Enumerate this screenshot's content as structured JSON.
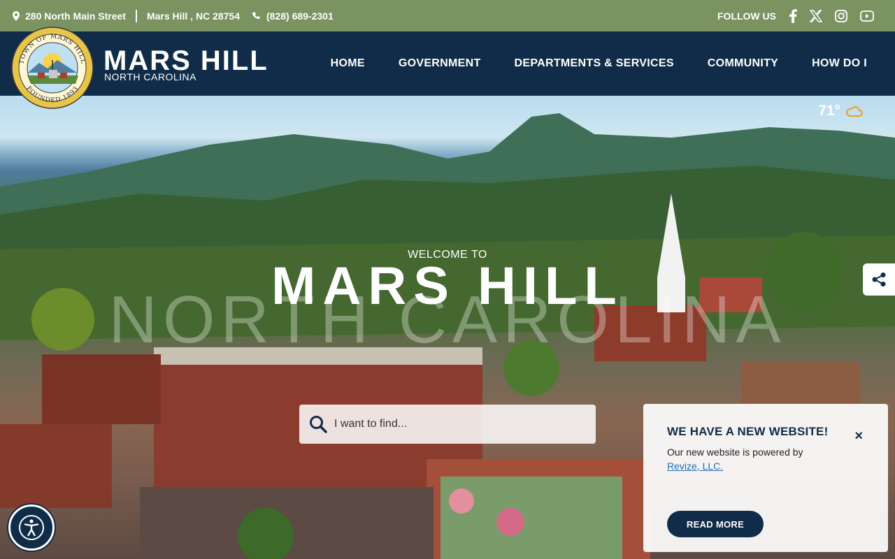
{
  "topbar": {
    "address": "280 North Main Street",
    "city": "Mars Hill , NC 28754",
    "phone": "(828) 689-2301",
    "follow_label": "FOLLOW US",
    "social_icons": [
      "facebook-icon",
      "x-icon",
      "instagram-icon",
      "youtube-icon"
    ]
  },
  "header": {
    "seal_text_top": "TOWN OF MARS HILL",
    "seal_text_bottom": "FOUNDED 1893",
    "brand_title": "MARS HILL",
    "brand_subtitle": "NORTH CAROLINA"
  },
  "nav": {
    "items": [
      {
        "label": "HOME"
      },
      {
        "label": "GOVERNMENT"
      },
      {
        "label": "DEPARTMENTS & SERVICES"
      },
      {
        "label": "COMMUNITY"
      },
      {
        "label": "HOW DO I"
      }
    ]
  },
  "hero": {
    "weather_temp": "71°",
    "welcome": "WELCOME TO",
    "title": "MARS HILL",
    "state": "NORTH CAROLINA",
    "search_placeholder": "I want to find..."
  },
  "popup": {
    "title": "WE HAVE A NEW WEBSITE!",
    "text": "Our new website is powered by",
    "link": "Revize, LLC.",
    "button": "READ MORE",
    "close": "×"
  },
  "colors": {
    "topbar": "#7a9360",
    "header": "#102c48",
    "accent_link": "#1e6fb8",
    "weather_icon": "#f39c12"
  }
}
